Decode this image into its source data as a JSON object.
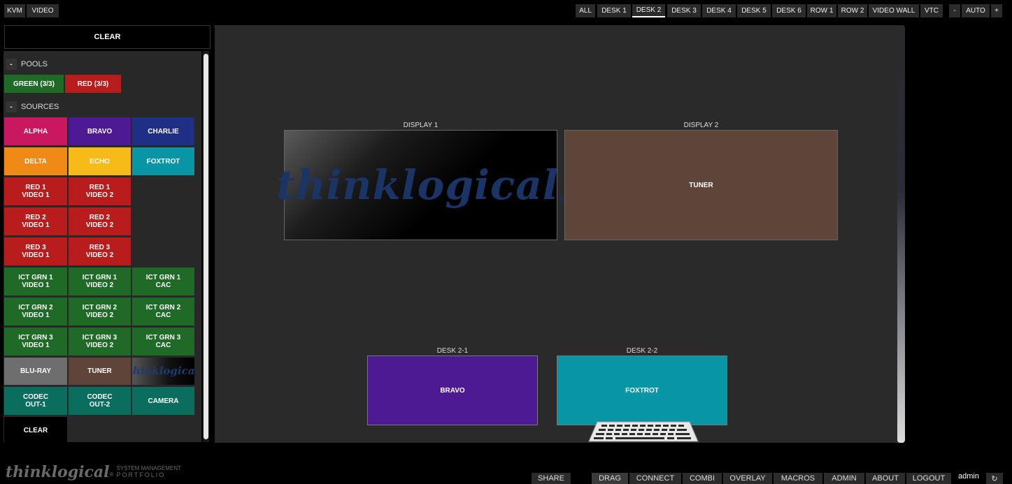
{
  "topbar": {
    "left": [
      "KVM",
      "VIDEO"
    ],
    "tabs": [
      "ALL",
      "DESK 1",
      "DESK 2",
      "DESK 3",
      "DESK 4",
      "DESK 5",
      "DESK 6",
      "ROW 1",
      "ROW 2",
      "VIDEO WALL",
      "VTC"
    ],
    "active_tab": "DESK 2",
    "zoom_minus": "-",
    "zoom_label": "AUTO",
    "zoom_plus": "+"
  },
  "sidebar": {
    "clear_top": "CLEAR",
    "pools_header": "POOLS",
    "collapse_symbol": "-",
    "pools": [
      {
        "label": "GREEN (3/3)",
        "color": "#1e6a26"
      },
      {
        "label": "RED (3/3)",
        "color": "#b81c1c"
      }
    ],
    "sources_header": "SOURCES",
    "sources": {
      "alpha": "ALPHA",
      "bravo": "BRAVO",
      "charlie": "CHARLIE",
      "delta": "DELTA",
      "echo": "ECHO",
      "foxtrot": "FOXTROT",
      "red1v1": "RED 1\nVIDEO 1",
      "red1v2": "RED 1\nVIDEO 2",
      "red2v1": "RED 2\nVIDEO 1",
      "red2v2": "RED 2\nVIDEO 2",
      "red3v1": "RED 3\nVIDEO 1",
      "red3v2": "RED 3\nVIDEO 2",
      "g1v1": "ICT GRN 1\nVIDEO 1",
      "g1v2": "ICT GRN 1\nVIDEO 2",
      "g1cac": "ICT GRN 1\nCAC",
      "g2v1": "ICT GRN 2\nVIDEO 1",
      "g2v2": "ICT GRN 2\nVIDEO 2",
      "g2cac": "ICT GRN 2\nCAC",
      "g3v1": "ICT GRN 3\nVIDEO 1",
      "g3v2": "ICT GRN 3\nVIDEO 2",
      "g3cac": "ICT GRN 3\nCAC",
      "bluray": "BLU-RAY",
      "tuner": "TUNER",
      "tklogo": "thinklogical",
      "codec1": "CODEC\nOUT-1",
      "codec2": "CODEC\nOUT-2",
      "camera": "CAMERA"
    },
    "clear_bottom": "CLEAR"
  },
  "canvas": {
    "display1_label": "DISPLAY 1",
    "display1_logo": "thinklogical",
    "display1_logo_mark": "®",
    "display2_label": "DISPLAY 2",
    "display2_content": "TUNER",
    "desk21_label": "DESK 2-1",
    "desk21_content": "BRAVO",
    "desk22_label": "DESK 2-2",
    "desk22_content": "FOXTROT"
  },
  "footer": {
    "brand": "thinklogical",
    "brand_mark": "®",
    "brand_sub1": "SYSTEM MANAGEMENT",
    "brand_sub2": "PORTFOLIO",
    "share": "SHARE",
    "modes": [
      "DRAG",
      "CONNECT",
      "COMBI",
      "OVERLAY",
      "MACROS",
      "ADMIN",
      "ABOUT",
      "LOGOUT"
    ],
    "user": "admin",
    "refresh_icon": "↻"
  },
  "colors": {
    "alpha": "#c9185f",
    "bravo": "#4d1a93",
    "charlie": "#1f2f86",
    "delta": "#f08a17",
    "echo": "#f6bb18",
    "foxtrot": "#0895a6",
    "red": "#b81c1c",
    "green": "#1e6a26",
    "bluray": "#6e6e6e",
    "tuner": "#5f443a",
    "codec": "#0a6d5e",
    "annotation_arrow": "#ee1111"
  }
}
